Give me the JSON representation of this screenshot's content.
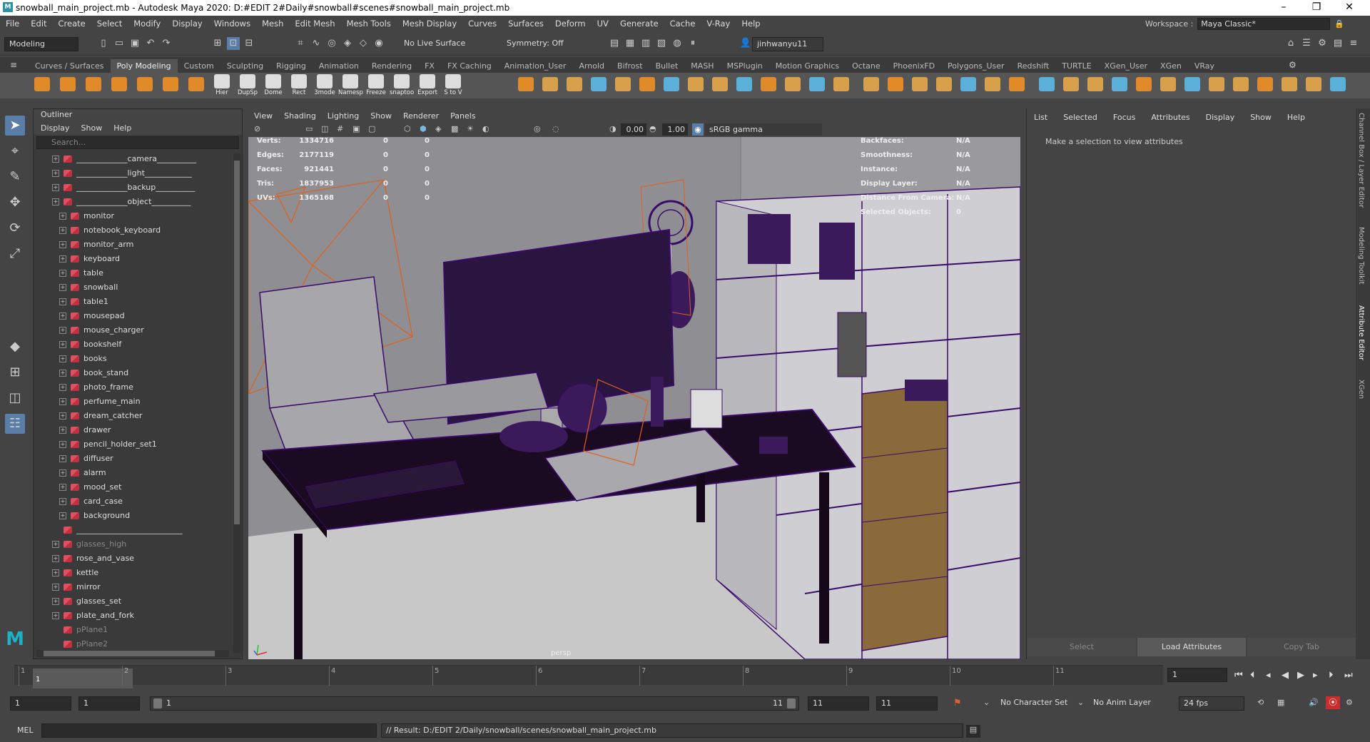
{
  "window": {
    "title": "snowball_main_project.mb - Autodesk Maya 2020: D:#EDIT 2#Daily#snowball#scenes#snowball_main_project.mb",
    "app_icon": "M",
    "minimize": "–",
    "maximize": "❐",
    "close": "✕"
  },
  "menubar": {
    "items": [
      "File",
      "Edit",
      "Create",
      "Select",
      "Modify",
      "Display",
      "Windows",
      "Mesh",
      "Edit Mesh",
      "Mesh Tools",
      "Mesh Display",
      "Curves",
      "Surfaces",
      "Deform",
      "UV",
      "Generate",
      "Cache",
      "V-Ray",
      "Help"
    ],
    "workspace_label": "Workspace :",
    "workspace_value": "Maya Classic*"
  },
  "statusline": {
    "mode": "Modeling",
    "live_surface": "No Live Surface",
    "symmetry": "Symmetry: Off",
    "user": "jinhwanyu11"
  },
  "shelf": {
    "tabs": [
      "Curves / Surfaces",
      "Poly Modeling",
      "Custom",
      "Sculpting",
      "Rigging",
      "Animation",
      "Rendering",
      "FX",
      "FX Caching",
      "Animation_User",
      "Arnold",
      "Bifrost",
      "Bullet",
      "MASH",
      "MSPlugin",
      "Motion Graphics",
      "Octane",
      "PhoenixFD",
      "Polygons_User",
      "Redshift",
      "TURTLE",
      "XGen_User",
      "XGen",
      "VRay"
    ],
    "active_tab": "Poly Modeling",
    "labeled_buttons": [
      "Hier",
      "DupSp",
      "Dome",
      "Rect",
      "3mode",
      "Namesp",
      "Freeze",
      "snaptoo",
      "Export",
      "S to V"
    ]
  },
  "outliner": {
    "title": "Outliner",
    "menu": [
      "Display",
      "Show",
      "Help"
    ],
    "search_placeholder": "Search...",
    "items": [
      {
        "label": "_____________camera__________",
        "level": 0,
        "dim": false
      },
      {
        "label": "_____________light____________",
        "level": 0,
        "dim": false
      },
      {
        "label": "_____________backup__________",
        "level": 0,
        "dim": false
      },
      {
        "label": "_____________object__________",
        "level": 0,
        "dim": false
      },
      {
        "label": "monitor",
        "level": 1,
        "dim": false
      },
      {
        "label": "notebook_keyboard",
        "level": 1,
        "dim": false
      },
      {
        "label": "monitor_arm",
        "level": 1,
        "dim": false
      },
      {
        "label": "keyboard",
        "level": 1,
        "dim": false
      },
      {
        "label": "table",
        "level": 1,
        "dim": false
      },
      {
        "label": "snowball",
        "level": 1,
        "dim": false
      },
      {
        "label": "table1",
        "level": 1,
        "dim": false
      },
      {
        "label": "mousepad",
        "level": 1,
        "dim": false
      },
      {
        "label": "mouse_charger",
        "level": 1,
        "dim": false
      },
      {
        "label": "bookshelf",
        "level": 1,
        "dim": false
      },
      {
        "label": "books",
        "level": 1,
        "dim": false
      },
      {
        "label": "book_stand",
        "level": 1,
        "dim": false
      },
      {
        "label": "photo_frame",
        "level": 1,
        "dim": false
      },
      {
        "label": "perfume_main",
        "level": 1,
        "dim": false
      },
      {
        "label": "dream_catcher",
        "level": 1,
        "dim": false
      },
      {
        "label": "drawer",
        "level": 1,
        "dim": false
      },
      {
        "label": "pencil_holder_set1",
        "level": 1,
        "dim": false
      },
      {
        "label": "diffuser",
        "level": 1,
        "dim": false
      },
      {
        "label": "alarm",
        "level": 1,
        "dim": false
      },
      {
        "label": "mood_set",
        "level": 1,
        "dim": false
      },
      {
        "label": "card_case",
        "level": 1,
        "dim": false
      },
      {
        "label": "background",
        "level": 1,
        "dim": false
      },
      {
        "label": "___________________________",
        "level": 0,
        "dim": false
      },
      {
        "label": "glasses_high",
        "level": 0,
        "dim": true
      },
      {
        "label": "rose_and_vase",
        "level": 0,
        "dim": false
      },
      {
        "label": "kettle",
        "level": 0,
        "dim": false
      },
      {
        "label": "mirror",
        "level": 0,
        "dim": false
      },
      {
        "label": "glasses_set",
        "level": 0,
        "dim": false
      },
      {
        "label": "plate_and_fork",
        "level": 0,
        "dim": false
      },
      {
        "label": "pPlane1",
        "level": 0,
        "dim": true
      },
      {
        "label": "pPlane2",
        "level": 0,
        "dim": true
      }
    ]
  },
  "viewport": {
    "menu": [
      "View",
      "Shading",
      "Lighting",
      "Show",
      "Renderer",
      "Panels"
    ],
    "exposure": "0.00",
    "gamma": "1.00",
    "colorspace": "sRGB gamma",
    "camera_label": "persp",
    "hud_left": [
      {
        "k": "Verts:",
        "a": "1334716",
        "b": "0",
        "c": "0"
      },
      {
        "k": "Edges:",
        "a": "2177119",
        "b": "0",
        "c": "0"
      },
      {
        "k": "Faces:",
        "a": "921441",
        "b": "0",
        "c": "0"
      },
      {
        "k": "Tris:",
        "a": "1837953",
        "b": "0",
        "c": "0"
      },
      {
        "k": "UVs:",
        "a": "1365168",
        "b": "0",
        "c": "0"
      }
    ],
    "hud_right": [
      {
        "k": "Backfaces:",
        "v": "N/A"
      },
      {
        "k": "Smoothness:",
        "v": "N/A"
      },
      {
        "k": "Instance:",
        "v": "N/A"
      },
      {
        "k": "Display Layer:",
        "v": "N/A"
      },
      {
        "k": "Distance From Camera:",
        "v": "N/A"
      },
      {
        "k": "Selected Objects:",
        "v": "0"
      }
    ]
  },
  "attribute_editor": {
    "menu": [
      "List",
      "Selected",
      "Focus",
      "Attributes",
      "Display",
      "Show",
      "Help"
    ],
    "message": "Make a selection to view attributes",
    "buttons": [
      "Select",
      "Load Attributes",
      "Copy Tab"
    ],
    "side_tabs": [
      "Channel Box / Layer Editor",
      "Modeling Toolkit",
      "Attribute Editor",
      "XGen"
    ]
  },
  "timeslider": {
    "ticks": [
      "1",
      "2",
      "3",
      "4",
      "5",
      "6",
      "7",
      "8",
      "9",
      "10",
      "11"
    ],
    "current_frame": "1"
  },
  "range": {
    "start": "1",
    "playback_start": "1",
    "range_slider_start": "1",
    "range_slider_end": "11",
    "playback_end": "11",
    "end": "11",
    "character_set": "No Character Set",
    "anim_layer": "No Anim Layer",
    "fps": "24 fps"
  },
  "cmdline": {
    "label": "MEL",
    "result": "// Result: D:/EDIT 2/Daily/snowball/scenes/snowball_main_project.mb"
  },
  "colors": {
    "wire_purple": "#3a0a6a",
    "locator_orange": "#e0601a",
    "shelf_orange": "#e08a2a"
  }
}
